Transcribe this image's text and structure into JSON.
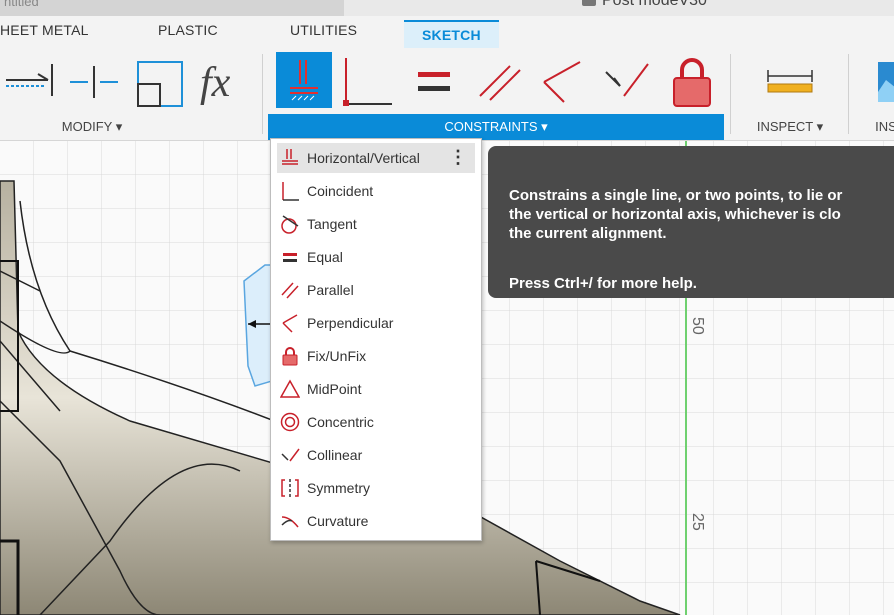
{
  "title_bar": {
    "left_tab_text": "ntitled",
    "document_title": "Post modeV30"
  },
  "tabs": [
    {
      "label": "HEET METAL"
    },
    {
      "label": "PLASTIC"
    },
    {
      "label": "UTILITIES"
    },
    {
      "label": "SKETCH",
      "active": true
    }
  ],
  "ribbon": {
    "groups": {
      "modify": "MODIFY ▾",
      "constraints": "CONSTRAINTS ▾",
      "inspect": "INSPECT ▾",
      "insert": "INS"
    },
    "tools": [
      {
        "icon": "trim-icon"
      },
      {
        "icon": "break-icon"
      },
      {
        "icon": "scale-icon"
      },
      {
        "icon": "fx-icon",
        "text": "fx"
      },
      {
        "icon": "horizontal-vertical-icon"
      },
      {
        "icon": "coincident-icon"
      },
      {
        "icon": "equal-icon"
      },
      {
        "icon": "parallel-icon"
      },
      {
        "icon": "perpendicular-icon"
      },
      {
        "icon": "collinear-icon"
      },
      {
        "icon": "fix-unfix-icon"
      },
      {
        "icon": "measure-icon"
      },
      {
        "icon": "insert-image-icon"
      }
    ]
  },
  "canvas": {
    "axis_labels": [
      "50",
      "25"
    ]
  },
  "menu": {
    "items": [
      {
        "label": "Horizontal/Vertical",
        "icon": "horizontal-vertical-icon",
        "hover": true,
        "more": "⋮"
      },
      {
        "label": "Coincident",
        "icon": "coincident-icon"
      },
      {
        "label": "Tangent",
        "icon": "tangent-icon"
      },
      {
        "label": "Equal",
        "icon": "equal-icon"
      },
      {
        "label": "Parallel",
        "icon": "parallel-icon"
      },
      {
        "label": "Perpendicular",
        "icon": "perpendicular-icon"
      },
      {
        "label": "Fix/UnFix",
        "icon": "fix-unfix-icon"
      },
      {
        "label": "MidPoint",
        "icon": "midpoint-icon"
      },
      {
        "label": "Concentric",
        "icon": "concentric-icon"
      },
      {
        "label": "Collinear",
        "icon": "collinear-icon"
      },
      {
        "label": "Symmetry",
        "icon": "symmetry-icon"
      },
      {
        "label": "Curvature",
        "icon": "curvature-icon"
      }
    ]
  },
  "tooltip": {
    "text": "Constrains a single line, or two points, to lie or\nthe vertical or horizontal axis, whichever is clo\nthe current alignment.",
    "help": "Press Ctrl+/ for more help."
  },
  "colors": {
    "accent": "#0a8bd8",
    "constraint_red": "#c8202a",
    "tooltip_bg": "#4a4a4a"
  }
}
